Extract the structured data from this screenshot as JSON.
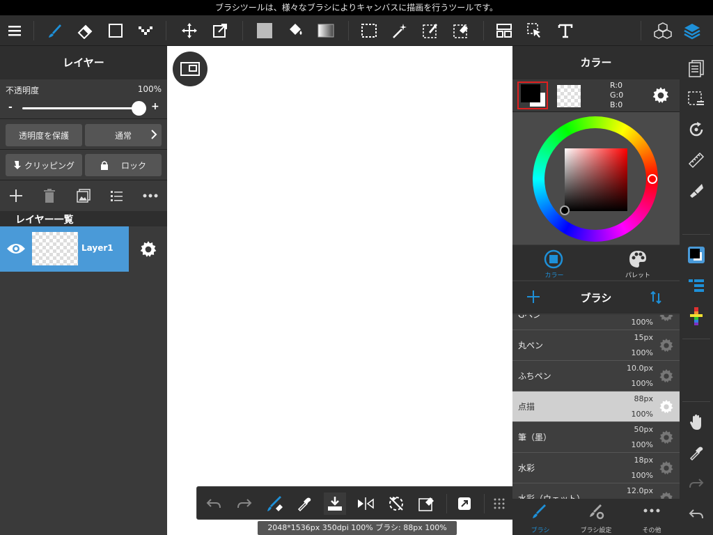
{
  "tooltip": "ブラシツールは、様々なブラシによりキャンバスに描画を行うツールです。",
  "colors": {
    "accent": "#1e90d8",
    "selected_layer": "#4a9ad8",
    "selected_color_border": "#e02020"
  },
  "toolbar": {
    "icons": [
      "menu-icon",
      "brush-icon",
      "eraser-icon",
      "rectangle-icon",
      "dot-pen-icon",
      "move-icon",
      "transform-icon",
      "fill-color-icon",
      "bucket-icon",
      "gradient-icon",
      "select-icon",
      "magic-wand-icon",
      "select-pen-icon",
      "select-eraser-icon",
      "frame-icon",
      "operation-icon",
      "text-icon",
      "3d-model-icon",
      "layers-icon"
    ]
  },
  "layer_panel": {
    "title": "レイヤー",
    "opacity_label": "不透明度",
    "opacity_value": "100%",
    "opacity": 1.0,
    "slider_minus": "-",
    "slider_plus": "+",
    "protect_alpha": "透明度を保護",
    "blend_mode": "通常",
    "clipping": "クリッピング",
    "lock": "ロック",
    "list_title": "レイヤー一覧",
    "layers": [
      {
        "name": "Layer1",
        "visible": true,
        "selected": true
      }
    ]
  },
  "color_panel": {
    "title": "カラー",
    "r": "R:0",
    "g": "G:0",
    "b": "B:0",
    "tab_color": "カラー",
    "tab_palette": "パレット"
  },
  "brush_panel": {
    "title": "ブラシ",
    "brushes": [
      {
        "name": "Gペン",
        "size": "",
        "opacity": "100%",
        "selected": false
      },
      {
        "name": "丸ペン",
        "size": "15px",
        "opacity": "100%",
        "selected": false
      },
      {
        "name": "ふちペン",
        "size": "10.0px",
        "opacity": "100%",
        "selected": false
      },
      {
        "name": "点描",
        "size": "88px",
        "opacity": "100%",
        "selected": true
      },
      {
        "name": "筆（墨）",
        "size": "50px",
        "opacity": "100%",
        "selected": false
      },
      {
        "name": "水彩",
        "size": "18px",
        "opacity": "100%",
        "selected": false
      },
      {
        "name": "水彩（ウェット）",
        "size": "12.0px",
        "opacity": "",
        "selected": false
      }
    ],
    "tab_brush": "ブラシ",
    "tab_brush_settings": "ブラシ設定",
    "tab_other": "その他"
  },
  "status": "2048*1536px 350dpi 100% ブラシ: 88px 100%"
}
